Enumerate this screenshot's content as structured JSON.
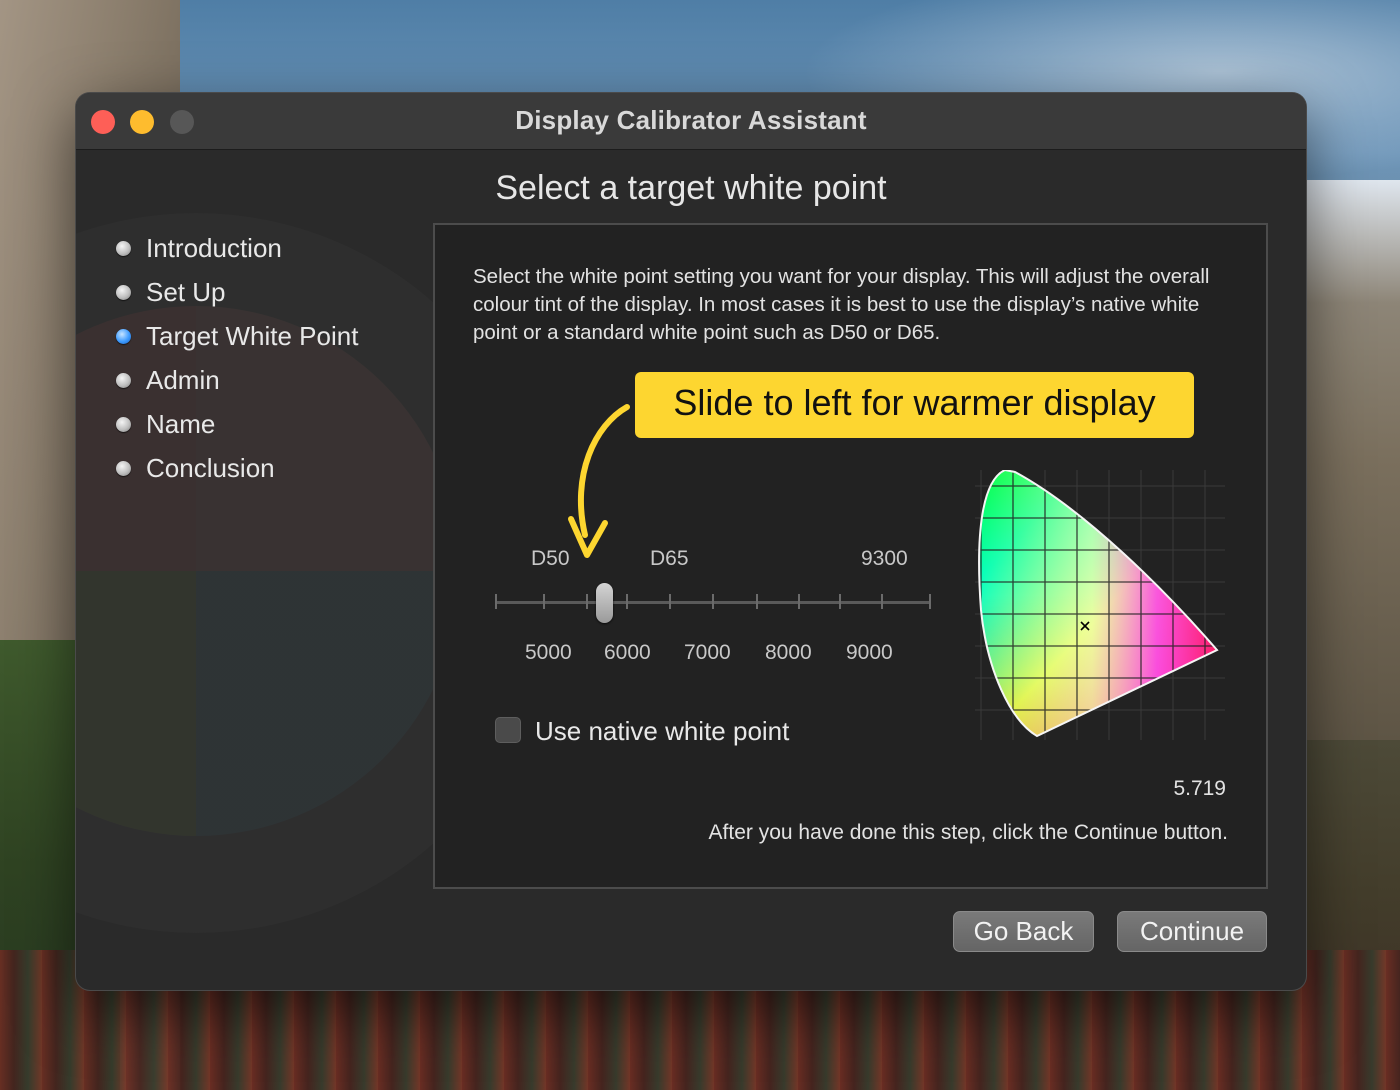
{
  "window": {
    "title": "Display Calibrator Assistant",
    "heading": "Select a target white point"
  },
  "steps": [
    {
      "label": "Introduction",
      "active": false
    },
    {
      "label": "Set Up",
      "active": false
    },
    {
      "label": "Target White Point",
      "active": true
    },
    {
      "label": "Admin",
      "active": false
    },
    {
      "label": "Name",
      "active": false
    },
    {
      "label": "Conclusion",
      "active": false
    }
  ],
  "description": "Select the white point setting you want for your display. This will adjust the overall colour tint of the display. In most cases it is best to use the display’s native white point or a standard white point such as D50 or D65.",
  "callout": "Slide to left for warmer display",
  "slider": {
    "presets": [
      "D50",
      "D65",
      "9300"
    ],
    "scale": [
      "5000",
      "6000",
      "7000",
      "8000",
      "9000"
    ],
    "value_kelvin": 5500
  },
  "native_checkbox": {
    "label": "Use native white point",
    "checked": false
  },
  "gamma_value": "5.719",
  "footer_text": "After you have done this step, click the Continue button.",
  "buttons": {
    "back": "Go Back",
    "continue": "Continue"
  },
  "colors": {
    "accent": "#fdd630",
    "selected_step": "#3d9bff"
  },
  "icons": [
    "close-button",
    "minimize-button",
    "zoom-button",
    "curved-arrow-icon",
    "chromaticity-diagram"
  ]
}
